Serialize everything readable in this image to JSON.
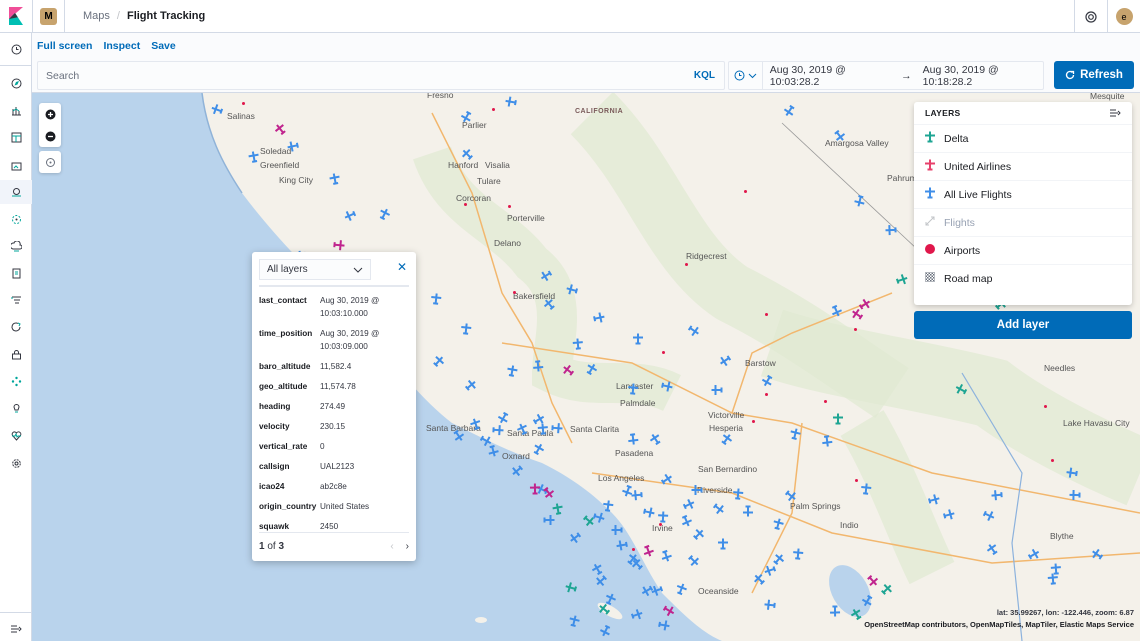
{
  "header": {
    "space_initial": "M",
    "breadcrumbs": [
      {
        "label": "Maps"
      },
      {
        "label": "Flight Tracking"
      }
    ],
    "user_initial": "e"
  },
  "toolbar": {
    "links": [
      "Full screen",
      "Inspect",
      "Save"
    ],
    "search_placeholder": "Search",
    "search_value": "",
    "query_language": "KQL",
    "date_start": "Aug 30, 2019 @ 10:03:28.2",
    "date_arrow": "→",
    "date_end": "Aug 30, 2019 @ 10:18:28.2",
    "refresh_label": "Refresh"
  },
  "sidenav": {
    "items": [
      "recently-viewed-icon",
      "discover-icon",
      "visualize-icon",
      "dashboard-icon",
      "canvas-icon",
      "maps-icon",
      "machine-learning-icon",
      "infrastructure-icon",
      "logs-icon",
      "apm-icon",
      "uptime-icon",
      "siem-icon",
      "dev-tools-icon",
      "stack-monitoring-icon",
      "heartbeat-icon",
      "management-icon"
    ],
    "collapse_icon": "menu-collapse-icon"
  },
  "layers_panel": {
    "title": "LAYERS",
    "layers": [
      {
        "name": "Delta",
        "icon": "airplane-icon",
        "color": "#1ea593",
        "visible": true
      },
      {
        "name": "United Airlines",
        "icon": "airplane-icon",
        "color": "#e7416b",
        "visible": true
      },
      {
        "name": "All Live Flights",
        "icon": "airplane-icon",
        "color": "#3f8ee8",
        "visible": true
      },
      {
        "name": "Flights",
        "icon": "line-icon",
        "color": "#c2c4c8",
        "visible": false
      },
      {
        "name": "Airports",
        "icon": "circle-icon",
        "color": "#e0174b",
        "visible": true
      },
      {
        "name": "Road map",
        "icon": "tile-icon",
        "color": "#69707d",
        "visible": true
      }
    ],
    "add_layer_label": "Add layer"
  },
  "tooltip": {
    "layer_select": "All layers",
    "properties": [
      {
        "key": "last_contact",
        "value": "Aug 30, 2019 @ 10:03:10.000"
      },
      {
        "key": "time_position",
        "value": "Aug 30, 2019 @ 10:03:09.000"
      },
      {
        "key": "baro_altitude",
        "value": "11,582.4"
      },
      {
        "key": "geo_altitude",
        "value": "11,574.78"
      },
      {
        "key": "heading",
        "value": "274.49"
      },
      {
        "key": "velocity",
        "value": "230.15"
      },
      {
        "key": "vertical_rate",
        "value": "0"
      },
      {
        "key": "callsign",
        "value": "UAL2123"
      },
      {
        "key": "icao24",
        "value": "ab2c8e"
      },
      {
        "key": "origin_country",
        "value": "United States"
      },
      {
        "key": "squawk",
        "value": "2450"
      }
    ],
    "page_current": "1",
    "page_of": "of",
    "page_total": "3"
  },
  "map": {
    "coords": "lat: 35.99267, lon: -122.446, zoom: 6.87",
    "attribution": "OpenStreetMap contributors, OpenMapTiles, MapTiler, Elastic Maps Service",
    "cities": [
      "Salinas",
      "Soledad",
      "Greenfield",
      "King City",
      "Fresno",
      "Parlier",
      "Hanford",
      "Visalia",
      "Tulare",
      "Corcoran",
      "Porterville",
      "Delano",
      "Bakersfield",
      "Ridgecrest",
      "Amargosa Valley",
      "Pahrump",
      "Mesquite",
      "Barstow",
      "Lancaster",
      "Palmdale",
      "Victorville",
      "Hesperia",
      "Santa Barbara",
      "Santa Paula",
      "Santa Clarita",
      "Oxnard",
      "Pasadena",
      "Los Angeles",
      "San Bernardino",
      "Riverside",
      "Irvine",
      "Oceanside",
      "Palm Springs",
      "Indio",
      "Needles",
      "Lake Havasu City",
      "Blythe",
      "CALIFORNIA"
    ]
  },
  "colors": {
    "accent": "#006bb8",
    "delta": "#1ea593",
    "united": "#e7416b",
    "all_flights": "#3f8ee8",
    "airport": "#e0174b",
    "ocean": "#b9d3ec",
    "land": "#f4f1ea",
    "park": "#dfe9d2"
  }
}
